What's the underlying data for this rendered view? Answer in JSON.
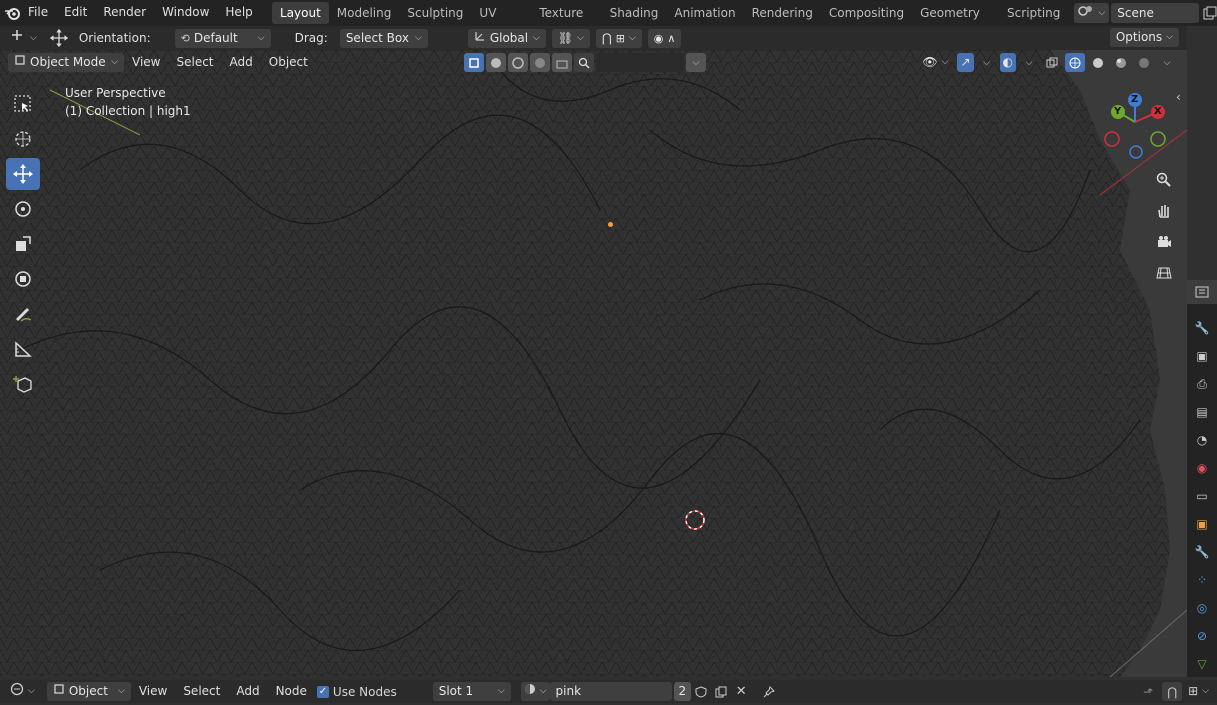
{
  "topbar": {
    "menus": [
      "File",
      "Edit",
      "Render",
      "Window",
      "Help"
    ],
    "workspaces": [
      "Layout",
      "Modeling",
      "Sculpting",
      "UV Editing",
      "Texture Paint",
      "Shading",
      "Animation",
      "Rendering",
      "Compositing",
      "Geometry Nodes",
      "Scripting"
    ],
    "active_workspace": "Layout",
    "scene_name": "Scene"
  },
  "tool_options": {
    "orientation_label": "Orientation:",
    "orientation_value": "Default",
    "drag_label": "Drag:",
    "drag_value": "Select Box",
    "transform_orientation": "Global",
    "options_label": "Options"
  },
  "viewport_header": {
    "mode": "Object Mode",
    "menus": [
      "View",
      "Select",
      "Add",
      "Object"
    ]
  },
  "overlay_text": {
    "perspective": "User Perspective",
    "collection": "(1) Collection | high1"
  },
  "gizmo": {
    "x": "X",
    "y": "Y",
    "z": "Z"
  },
  "bottombar": {
    "editor_mode": "Object",
    "menus": [
      "View",
      "Select",
      "Add",
      "Node"
    ],
    "use_nodes_label": "Use Nodes",
    "use_nodes_checked": true,
    "slot_value": "Slot 1",
    "material_name": "pink",
    "user_count": "2"
  },
  "colors": {
    "accent": "#4772b3",
    "header": "#232323",
    "x_axis": "#d0303a",
    "y_axis": "#6ea82f",
    "z_axis": "#3d7fd8",
    "origin": "#ff9b2f"
  },
  "icons": {
    "left_tools": [
      "select-box-icon",
      "cursor-icon",
      "move-icon",
      "rotate-icon",
      "scale-icon",
      "transform-icon",
      "annotate-icon",
      "measure-icon",
      "add-cube-icon"
    ],
    "nav": [
      "zoom-icon",
      "hand-pan-icon",
      "camera-icon",
      "grid-ortho-icon"
    ],
    "properties": [
      "tool-icon",
      "render-icon",
      "output-icon",
      "view-layer-icon",
      "scene-icon",
      "world-icon",
      "collection-icon",
      "object-icon",
      "modifier-icon",
      "particles-icon",
      "physics-icon",
      "constraints-icon",
      "data-icon"
    ]
  }
}
